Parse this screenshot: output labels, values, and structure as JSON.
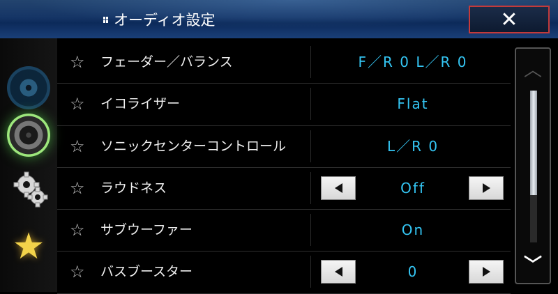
{
  "header": {
    "title": "オーディオ設定",
    "close_label": "✕"
  },
  "sidebar": {
    "items": [
      {
        "name": "disc-icon"
      },
      {
        "name": "speaker-icon",
        "active": true
      },
      {
        "name": "gear-icon"
      },
      {
        "name": "star-icon"
      }
    ]
  },
  "settings": [
    {
      "label": "フェーダー／バランス",
      "value": "F／R 0 L／R 0",
      "arrows": false
    },
    {
      "label": "イコライザー",
      "value": "Flat",
      "arrows": false
    },
    {
      "label": "ソニックセンターコントロール",
      "value": "L／R 0",
      "arrows": false
    },
    {
      "label": "ラウドネス",
      "value": "Off",
      "arrows": true
    },
    {
      "label": "サブウーファー",
      "value": "On",
      "arrows": false
    },
    {
      "label": "バスブースター",
      "value": "0",
      "arrows": true
    }
  ],
  "scroll": {
    "up_label": "︿",
    "down_label": "﹀",
    "position": 0.0
  },
  "colors": {
    "accent": "#34c6f4",
    "header": "#153566",
    "close_border": "#c43a3a"
  }
}
